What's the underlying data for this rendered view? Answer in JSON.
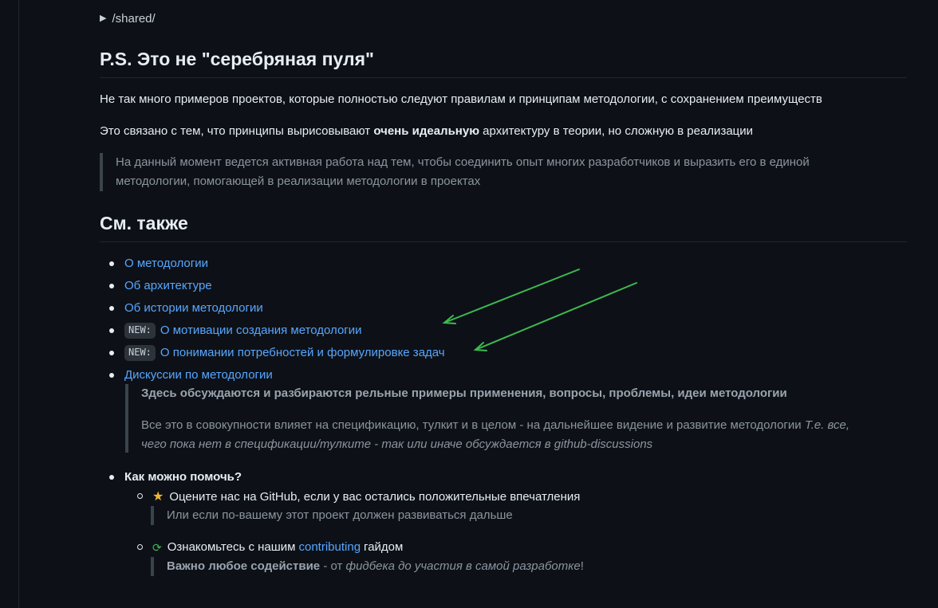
{
  "details": {
    "summary": "/shared/"
  },
  "section_ps": {
    "heading": "P.S. Это не \"серебряная пуля\"",
    "p1": "Не так много примеров проектов, которые полностью следуют правилам и принципам методологии, с сохранением преимуществ",
    "p2_before": "Это связано с тем, что принципы вырисовывают ",
    "p2_bold": "очень идеальную",
    "p2_after": " архитектуру в теории, но сложную в реализации",
    "quote_line1": "На данный момент ведется активная работа над тем, чтобы соединить опыт многих разработчиков и выразить его в единой",
    "quote_line2": "методологии, помогающей в реализации методологии в проектах"
  },
  "section_see_also": {
    "heading": "См. также",
    "links": [
      {
        "label": "О методологии"
      },
      {
        "label": "Об архитектуре"
      },
      {
        "label": "Об истории методологии"
      },
      {
        "badge": "NEW:",
        "label": "О мотивации создания методологии"
      },
      {
        "badge": "NEW:",
        "label": "О понимании потребностей и формулировке задач"
      },
      {
        "label": "Дискуссии по методологии"
      }
    ],
    "discussion_quote_bold": "Здесь обсуждаются и разбираются рельные примеры применения, вопросы, проблемы, идеи методологии",
    "discussion_quote_line2_before": "Все это в совокупности влияет на спецификацию, тулкит и в целом - на дальнейшее видение и развитие методологии ",
    "discussion_quote_line2_em": "Т.е. все,",
    "discussion_quote_line3_em": "чего пока нет в спецификации/тулките - так или иначе обсуждается в github-discussions"
  },
  "help": {
    "title": "Как можно помочь?",
    "item1": "Оцените нас на GitHub, если у вас остались положительные впечатления",
    "item1_quote": "Или если по-вашему этот проект должен развиваться дальше",
    "item2_before": "Ознакомьтесь с нашим ",
    "item2_link": "contributing",
    "item2_after": " гайдом",
    "item2_quote_bold": "Важно любое содействие",
    "item2_quote_mid": " - от ",
    "item2_quote_em": "фидбека до участия в самой разработке",
    "item2_quote_end": "!"
  },
  "icons": {
    "star": "star-icon",
    "cycle": "cycle-icon",
    "arrow": "green-arrow-annotation"
  },
  "colors": {
    "background": "#0d1117",
    "link": "#58a6ff",
    "arrow": "#3fb950",
    "star": "#f0b72f"
  }
}
